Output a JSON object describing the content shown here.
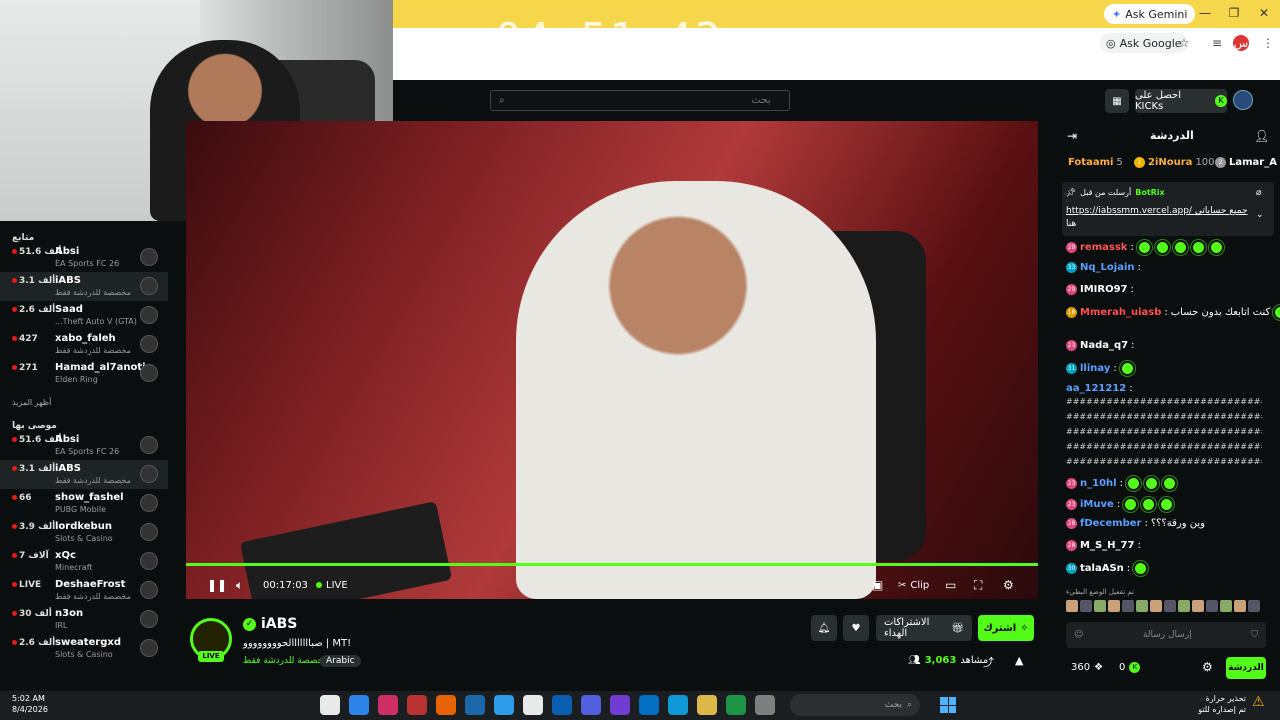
{
  "browser": {
    "gemini_label": "Ask Gemini",
    "ask_google_label": "Ask Google",
    "timer_overlay": "04:51:43"
  },
  "header": {
    "search_placeholder": "بحث",
    "get_kicks_label": "احصل على KICKs"
  },
  "sidebar": {
    "following_title": "متابع",
    "following": [
      {
        "count": "51.6 ألف",
        "name": "Absi",
        "game": "EA Sports FC 26"
      },
      {
        "count": "3.1 ألف",
        "name": "iABS",
        "game": "مخصصة للدردشة فقط",
        "active": true
      },
      {
        "count": "2.6 ألف",
        "name": "Saad",
        "game": "...Theft Auto V (GTA)"
      },
      {
        "count": "427",
        "name": "xabo_faleh",
        "game": "مخصصة للدردشة فقط"
      },
      {
        "count": "271",
        "name": "Hamad_al7anoti",
        "game": "Elden Ring"
      }
    ],
    "show_more": "أظهر المزيد",
    "recommended_title": "موصى بها",
    "recommended": [
      {
        "count": "51.6 ألف",
        "name": "Absi",
        "game": "EA Sports FC 26"
      },
      {
        "count": "3.1 ألف",
        "name": "iABS",
        "game": "مخصصة للدردشة فقط",
        "active": true
      },
      {
        "count": "66",
        "name": "show_fashel",
        "game": "PUBG Mobile"
      },
      {
        "count": "3.9 ألف",
        "name": "lordkebun",
        "game": "Slots & Casino"
      },
      {
        "count": "7 آلاف",
        "name": "xQc",
        "game": "Minecraft"
      },
      {
        "count": "LIVE",
        "name": "DeshaeFrost",
        "game": "مخصصة للدردشة فقط"
      },
      {
        "count": "30 ألف",
        "name": "n3on",
        "game": "IRL"
      },
      {
        "count": "2.6 ألف",
        "name": "sweatergxd",
        "game": "Slots & Casino"
      }
    ]
  },
  "player": {
    "time": "00:17:03",
    "live_label": "LIVE",
    "clip_label": "Clip",
    "progress": 1.0
  },
  "stream": {
    "streamer": "iABS",
    "title": "صبااااااالحوووووووو | MT!",
    "category": "مخصصة للدردشة فقط",
    "language_tag": "Arabic",
    "viewers": "3,063",
    "viewers_label": "مشاهد",
    "live_badge": "LIVE",
    "subscribe_label": "اشترك",
    "gift_subs_label": "الاشتراكات الهداء"
  },
  "chat": {
    "title": "الدردشة",
    "leaderboard": [
      {
        "name": "Lamar_A",
        "rank": "2"
      },
      {
        "name": "2iNoura",
        "value": "100"
      },
      {
        "name": "Fotaami",
        "value": "5"
      }
    ],
    "pinned": {
      "author": "BotRix",
      "header": "أرسلت من قبل",
      "text": "https://iabssmm.vercel.app/ جميع حساباتي",
      "tail": "هنا"
    },
    "messages": [
      {
        "badge": "29",
        "user": "remassk",
        "color": "#ff5555",
        "emotes": 5
      },
      {
        "badge": "33",
        "user": "Nq_Lojain",
        "color": "#57a0ff",
        "emotes": 0
      },
      {
        "badge": "29",
        "user": "IMIRO97",
        "color": "#ffffff",
        "emotes": 0
      },
      {
        "badge": "18",
        "user": "Mmerah_uiasb",
        "color": "#ff4d4d",
        "text": "كنت اتابعك بدون حساب",
        "emotes": 3
      },
      {
        "badge": "23",
        "user": "Nada_q7",
        "color": "#ffffff",
        "emotes": 0
      },
      {
        "badge": "31",
        "user": "llinay",
        "color": "#57a0ff",
        "emotes": 1
      },
      {
        "badge": "",
        "user": "aa_121212",
        "color": "#57a0ff",
        "text": "",
        "emotes": 0
      },
      {
        "badge": "23",
        "user": "n_10hl",
        "color": "#57a0ff",
        "emotes": 3
      },
      {
        "badge": "23",
        "user": "iMuve",
        "color": "#57a0ff",
        "emotes": 3
      },
      {
        "badge": "28",
        "user": "fDecember",
        "color": "#57a0ff",
        "text": "وين ورقة؟؟؟",
        "emotes": 0
      },
      {
        "badge": "28",
        "user": "M_S_H_77",
        "color": "#ffffff",
        "emotes": 0
      },
      {
        "badge": "30",
        "user": "talaASn",
        "color": "#ffffff",
        "emotes": 1
      }
    ],
    "spam_text": "#################################################",
    "slow_mode_notice": "تم تفعيل الوضع البطيء",
    "input_placeholder": "إرسال رسالة",
    "points": "360",
    "kicks": "0",
    "send_label": "الدردشة"
  },
  "taskbar": {
    "time": "5:02 AM",
    "date": "8/4/2026",
    "search_label": "بحث",
    "weather_title": "تحذير حرارة",
    "weather_sub": "تم إصداره للتو"
  }
}
